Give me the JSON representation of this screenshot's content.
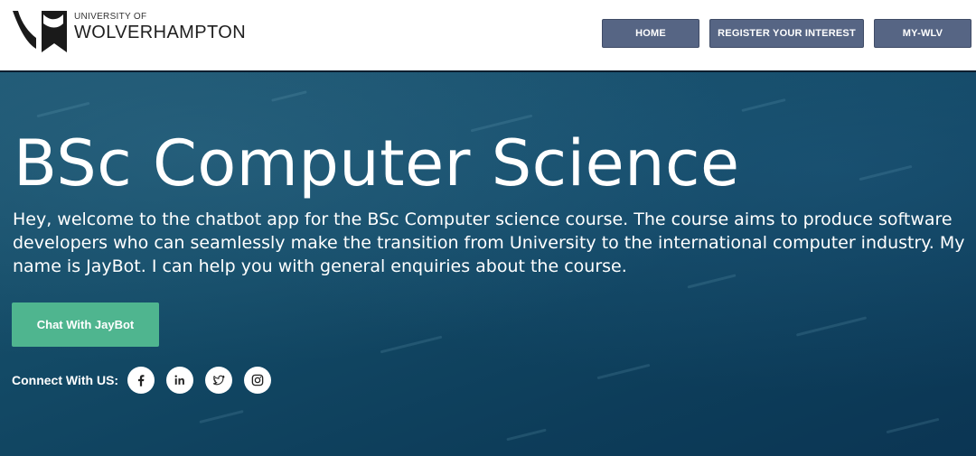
{
  "brand": {
    "line1": "UNIVERSITY OF",
    "line2": "WOLVERHAMPTON"
  },
  "nav": {
    "home": "HOME",
    "register": "REGISTER YOUR INTEREST",
    "mywlv": "MY-WLV"
  },
  "hero": {
    "title": "BSc Computer Science",
    "description": "Hey, welcome to the chatbot app for the BSc Computer science course. The course aims to produce software developers who can seamlessly make the transition from University to the international computer industry. My name is JayBot. I can help you with general enquiries about the course.",
    "cta_label": "Chat With JayBot"
  },
  "social": {
    "label": "Connect With US:",
    "icons": [
      "facebook-icon",
      "linkedin-icon",
      "twitter-icon",
      "instagram-icon"
    ]
  },
  "colors": {
    "nav_button": "#566584",
    "cta": "#4fb58f",
    "hero_bg": "#134a66"
  }
}
